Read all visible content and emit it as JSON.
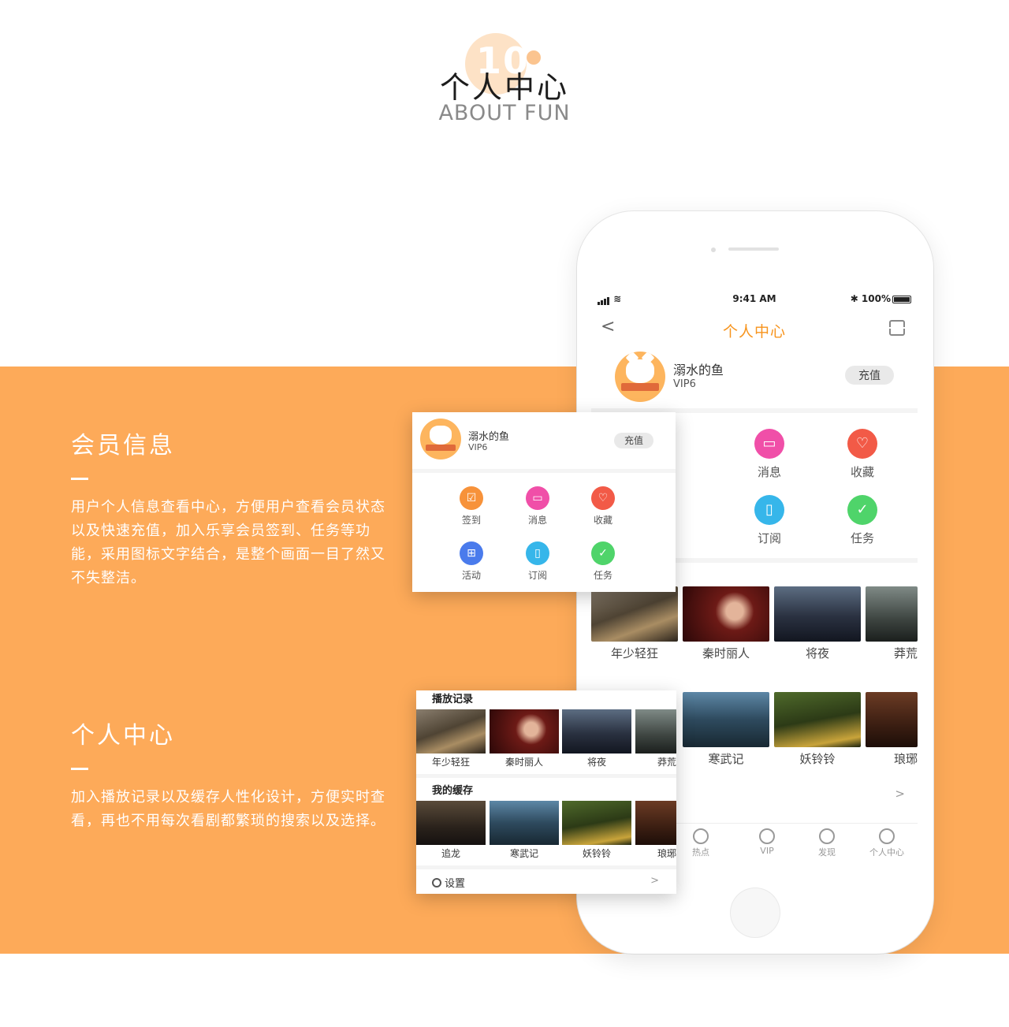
{
  "header": {
    "number": "10",
    "title": "个人中心",
    "subtitle": "ABOUT FUN"
  },
  "sections": [
    {
      "title": "会员信息",
      "text": "用户个人信息查看中心，方便用户查看会员状态以及快速充值，加入乐享会员签到、任务等功能，采用图标文字结合，是整个画面一目了然又不失整洁。"
    },
    {
      "title": "个人中心",
      "text": "加入播放记录以及缓存人性化设计，方便实时查看，再也不用每次看剧都繁琐的搜索以及选择。"
    }
  ],
  "phone": {
    "status": {
      "time": "9:41 AM",
      "battery": "100%"
    },
    "nav": {
      "title": "个人中心",
      "back": "<"
    },
    "profile": {
      "name": "溺水的鱼",
      "vip": "VIP6",
      "recharge": "充值"
    },
    "grid": [
      {
        "label": "消息",
        "icon": "message-icon",
        "color": "#f04fa8"
      },
      {
        "label": "收藏",
        "icon": "heart-icon",
        "color": "#f25a47"
      },
      {
        "label": "订阅",
        "icon": "book-icon",
        "color": "#36b6ea"
      },
      {
        "label": "任务",
        "icon": "task-icon",
        "color": "#4fd46a"
      }
    ],
    "history": [
      "年少轻狂",
      "秦时丽人",
      "将夜",
      "莽荒"
    ],
    "cache": [
      "寒武记",
      "妖铃铃",
      "琅琊"
    ],
    "more_arrow": ">",
    "tabs": [
      "热点",
      "VIP",
      "发现",
      "个人中心"
    ]
  },
  "card1": {
    "name": "溺水的鱼",
    "vip": "VIP6",
    "recharge": "充值",
    "items": [
      {
        "label": "签到",
        "icon": "checkin-icon",
        "color": "#f7923a"
      },
      {
        "label": "消息",
        "icon": "message-icon",
        "color": "#f04fa8"
      },
      {
        "label": "收藏",
        "icon": "heart-icon",
        "color": "#f25a47"
      },
      {
        "label": "活动",
        "icon": "gift-icon",
        "color": "#4a7bec"
      },
      {
        "label": "订阅",
        "icon": "book-icon",
        "color": "#36b6ea"
      },
      {
        "label": "任务",
        "icon": "task-icon",
        "color": "#4fd46a"
      }
    ]
  },
  "card2": {
    "history_title": "播放记录",
    "history": [
      "年少轻狂",
      "秦时丽人",
      "将夜",
      "莽荒"
    ],
    "cache_title": "我的缓存",
    "cache": [
      "追龙",
      "寒武记",
      "妖铃铃",
      "琅琊"
    ],
    "settings": "设置",
    "arrow": ">"
  }
}
